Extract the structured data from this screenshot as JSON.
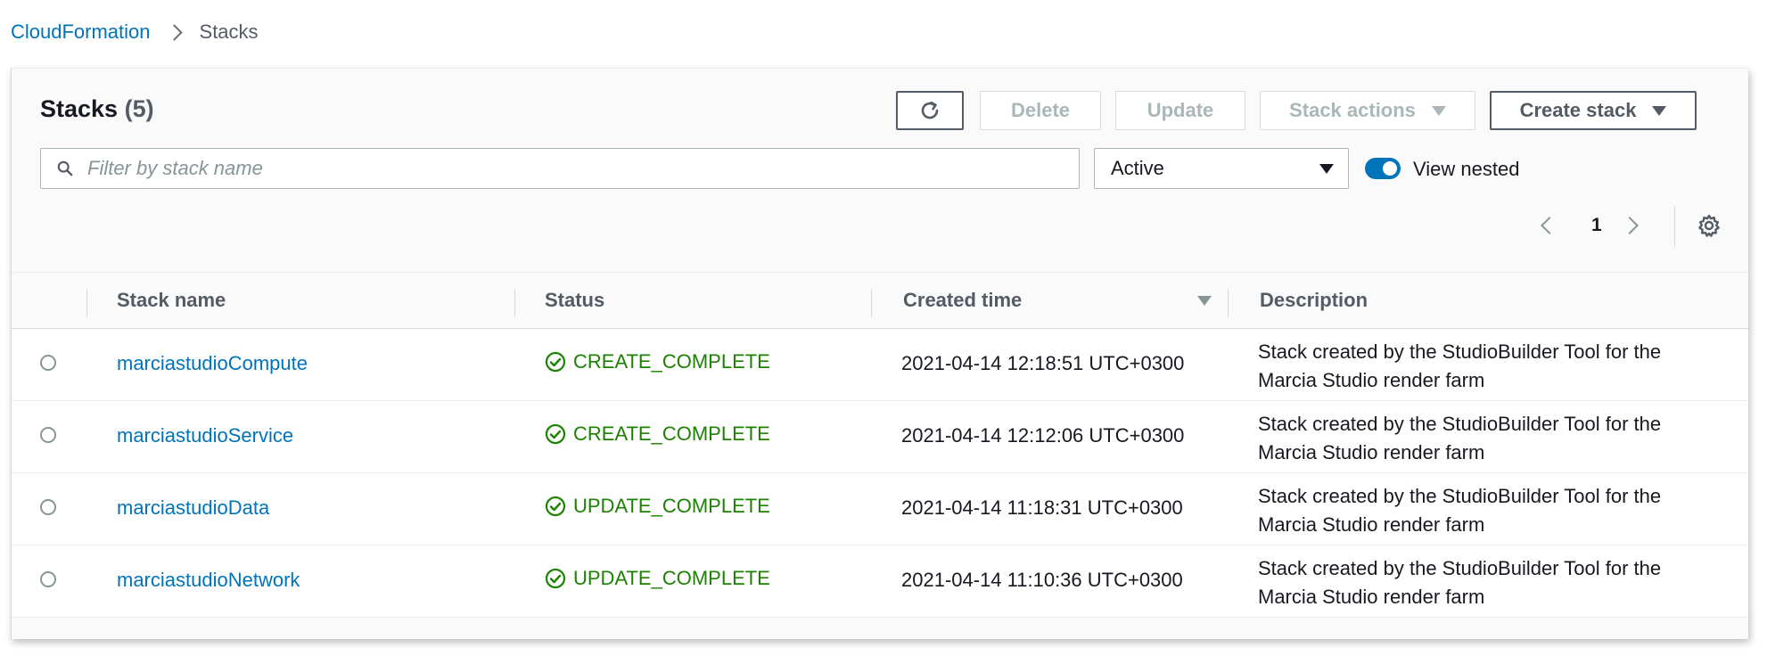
{
  "breadcrumb": {
    "root": "CloudFormation",
    "current": "Stacks"
  },
  "header": {
    "title": "Stacks",
    "count": "(5)",
    "refresh_icon": "refresh-icon",
    "delete_label": "Delete",
    "update_label": "Update",
    "stack_actions_label": "Stack actions",
    "create_stack_label": "Create stack"
  },
  "filter": {
    "placeholder": "Filter by stack name",
    "status_selected": "Active",
    "view_nested_label": "View nested",
    "view_nested_on": true
  },
  "pagination": {
    "current_page": "1"
  },
  "table": {
    "columns": {
      "stack_name": "Stack name",
      "status": "Status",
      "created_time": "Created time",
      "description": "Description"
    },
    "rows": [
      {
        "name": "marciastudioCompute",
        "status": "CREATE_COMPLETE",
        "created": "2021-04-14 12:18:51 UTC+0300",
        "description": "Stack created by the StudioBuilder Tool for the Marcia Studio render farm"
      },
      {
        "name": "marciastudioService",
        "status": "CREATE_COMPLETE",
        "created": "2021-04-14 12:12:06 UTC+0300",
        "description": "Stack created by the StudioBuilder Tool for the Marcia Studio render farm"
      },
      {
        "name": "marciastudioData",
        "status": "UPDATE_COMPLETE",
        "created": "2021-04-14 11:18:31 UTC+0300",
        "description": "Stack created by the StudioBuilder Tool for the Marcia Studio render farm"
      },
      {
        "name": "marciastudioNetwork",
        "status": "UPDATE_COMPLETE",
        "created": "2021-04-14 11:10:36 UTC+0300",
        "description": "Stack created by the StudioBuilder Tool for the Marcia Studio render farm"
      }
    ]
  },
  "colors": {
    "link": "#0073bb",
    "success": "#1d8102",
    "text": "#16191f",
    "muted": "#545b64"
  }
}
